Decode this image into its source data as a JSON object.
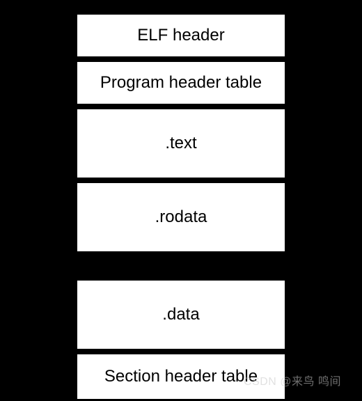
{
  "blocks": [
    {
      "label": "ELF header"
    },
    {
      "label": "Program header table"
    },
    {
      "label": ".text"
    },
    {
      "label": ".rodata"
    },
    {
      "label": ".data"
    },
    {
      "label": "Section header table"
    }
  ],
  "watermark": "CSDN @来鸟 鸣间"
}
